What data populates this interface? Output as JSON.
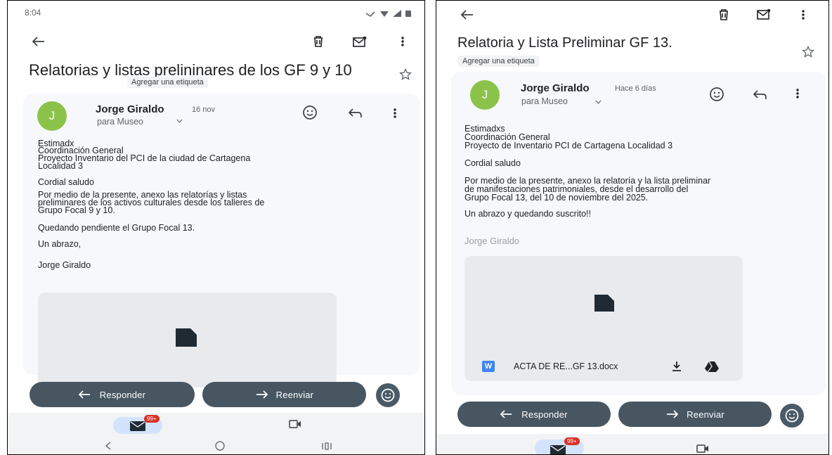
{
  "left": {
    "status_time": "8:04",
    "subject": "Relatorias y listas prelininares de los GF 9 y 10",
    "label_chip": "Agregar una etiqueta",
    "sender_initial": "J",
    "sender": "Jorge Giraldo",
    "date": "16 nov",
    "recipient": "para Museo",
    "body": [
      "Estimadx",
      "Coordinación General",
      "Proyecto Inventario del PCI de la ciudad de Cartagena",
      "Localidad 3",
      "Cordial saludo",
      "Por medio de la presente, anexo las relatorías y listas",
      "preliminares de los activos culturales desde los talleres de",
      "Grupo Focal 9 y 10.",
      "Quedando pendiente el Grupo Focal 13.",
      "Un abrazo,",
      "Jorge Giraldo"
    ],
    "reply_label": "Responder",
    "forward_label": "Reenviar",
    "mail_badge": "99+",
    "icons": [
      "back-arrow",
      "trash",
      "mark-unread",
      "more-vert",
      "star",
      "smiley",
      "reply",
      "forward",
      "file",
      "mail",
      "video",
      "nav-back",
      "nav-home",
      "nav-recents"
    ]
  },
  "right": {
    "subject": "Relatoria y Lista Preliminar GF 13.",
    "label_chip": "Agregar una etiqueta",
    "sender_initial": "J",
    "sender": "Jorge Giraldo",
    "date": "Hace 6 días",
    "recipient": "para Museo",
    "body": [
      "Estimadxs",
      "Coordinación General",
      "Proyecto de Inventario PCI de Cartagena Localidad 3",
      "Cordial saludo",
      "Por medio de la presente, anexo la relatoría y la lista preliminar",
      "de manifestaciones patrimoniales, desde el desarrollo del",
      "Grupo Focal 13, del 10 de noviembre del 2025.",
      "Un abrazo y quedando suscrito!!"
    ],
    "signature": "Jorge Giraldo",
    "attachment_badge": "W",
    "attachment_name": "ACTA DE RE...GF 13.docx",
    "reply_label": "Responder",
    "forward_label": "Reenviar",
    "mail_badge": "99+"
  },
  "colors": {
    "pill": "#475661",
    "avatar": "#8bc34a",
    "badge": "#d93025",
    "word": "#4285f4"
  }
}
